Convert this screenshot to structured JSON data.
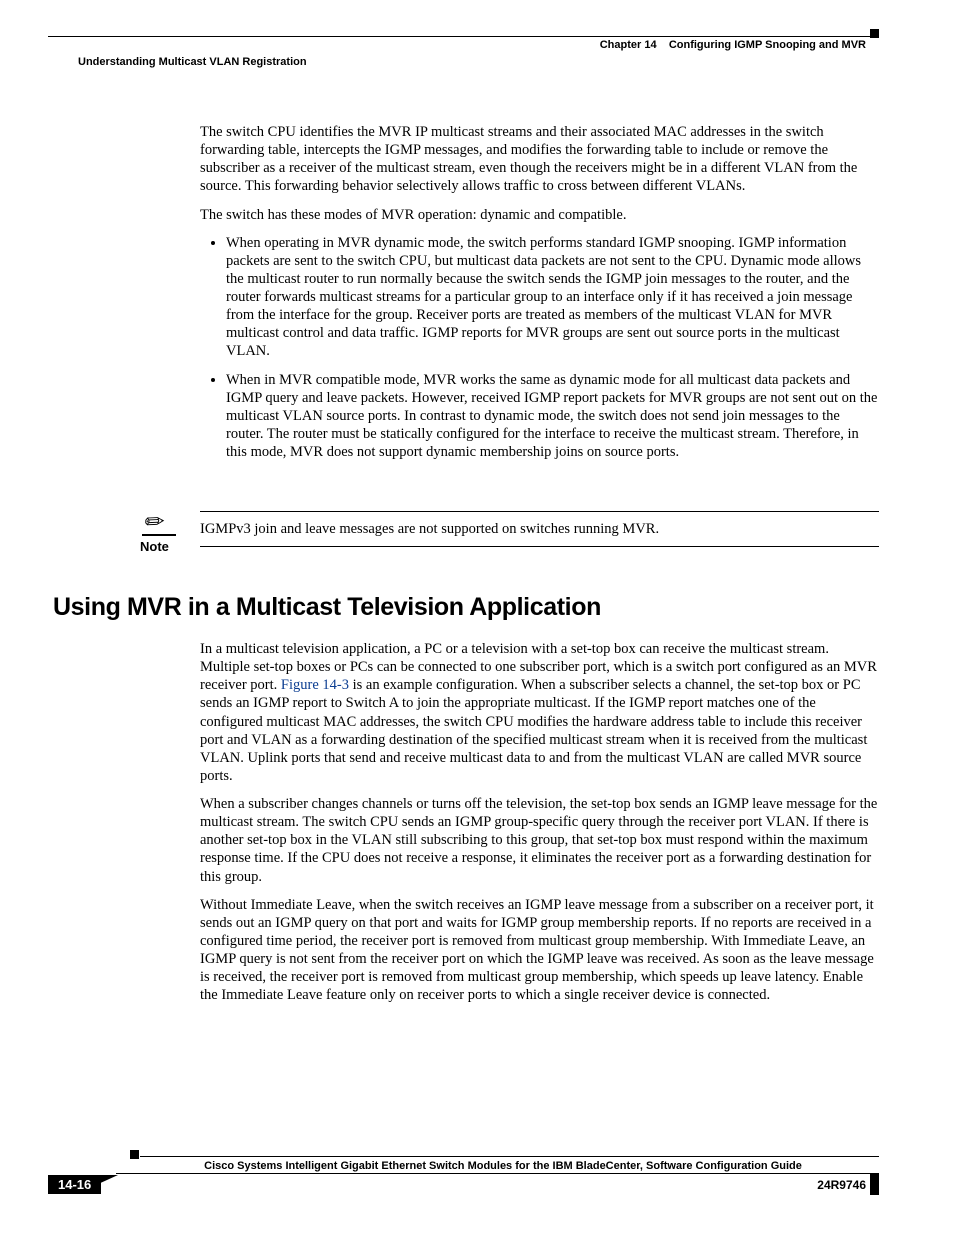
{
  "header": {
    "chapter_label": "Chapter 14",
    "chapter_title": "Configuring IGMP Snooping and MVR",
    "section_title": "Understanding Multicast VLAN Registration"
  },
  "content": {
    "p1": "The switch CPU identifies the MVR IP multicast streams and their associated MAC addresses in the switch forwarding table, intercepts the IGMP messages, and modifies the forwarding table to include or remove the subscriber as a receiver of the multicast stream, even though the receivers might be in a different VLAN from the source. This forwarding behavior selectively allows traffic to cross between different VLANs.",
    "p2": "The switch has these modes of MVR operation: dynamic and compatible.",
    "bullet1": "When operating in MVR dynamic mode, the switch performs standard IGMP snooping. IGMP information packets are sent to the switch CPU, but multicast data packets are not sent to the CPU. Dynamic mode allows the multicast router to run normally because the switch sends the IGMP join messages to the router, and the router forwards multicast streams for a particular group to an interface only if it has received a join message from the interface for the group. Receiver ports are treated as members of the multicast VLAN for MVR multicast control and data traffic. IGMP reports for MVR groups are sent out source ports in the multicast VLAN.",
    "bullet2": "When in MVR compatible mode, MVR works the same as dynamic mode for all multicast data packets and IGMP query and leave packets. However, received IGMP report packets for MVR groups are not sent out on the multicast VLAN source ports. In contrast to dynamic mode, the switch does not send join messages to the router. The router must be statically configured for the interface to receive the multicast stream. Therefore, in this mode, MVR does not support dynamic membership joins on source ports.",
    "note_label": "Note",
    "note_text": "IGMPv3 join and leave messages are not supported on switches running MVR.",
    "h2": "Using MVR in a Multicast Television Application",
    "p3a": "In a multicast television application, a PC or a television with a set-top box can receive the multicast stream. Multiple set-top boxes or PCs can be connected to one subscriber port, which is a switch port configured as an MVR receiver port. ",
    "p3_link": "Figure 14-3",
    "p3b": " is an example configuration. When a subscriber selects a channel, the set-top box or PC sends an IGMP report to Switch A to join the appropriate multicast. If the IGMP report matches one of the configured multicast MAC addresses, the switch CPU modifies the hardware address table to include this receiver port and VLAN as a forwarding destination of the specified multicast stream when it is received from the multicast VLAN. Uplink ports that send and receive multicast data to and from the multicast VLAN are called MVR source ports.",
    "p4": "When a subscriber changes channels or turns off the television, the set-top box sends an IGMP leave message for the multicast stream. The switch CPU sends an IGMP group-specific query through the receiver port VLAN. If there is another set-top box in the VLAN still subscribing to this group, that set-top box must respond within the maximum response time. If the CPU does not receive a response, it eliminates the receiver port as a forwarding destination for this group.",
    "p5": "Without Immediate Leave, when the switch receives an IGMP leave message from a subscriber on a receiver port, it sends out an IGMP query on that port and waits for IGMP group membership reports. If no reports are received in a configured time period, the receiver port is removed from multicast group membership. With Immediate Leave, an IGMP query is not sent from the receiver port on which the IGMP leave was received. As soon as the leave message is received, the receiver port is removed from multicast group membership, which speeds up leave latency. Enable the Immediate Leave feature only on receiver ports to which a single receiver device is connected."
  },
  "footer": {
    "book_title": "Cisco Systems Intelligent Gigabit Ethernet Switch Modules for the IBM BladeCenter, Software Configuration Guide",
    "page_number": "14-16",
    "doc_number": "24R9746"
  }
}
